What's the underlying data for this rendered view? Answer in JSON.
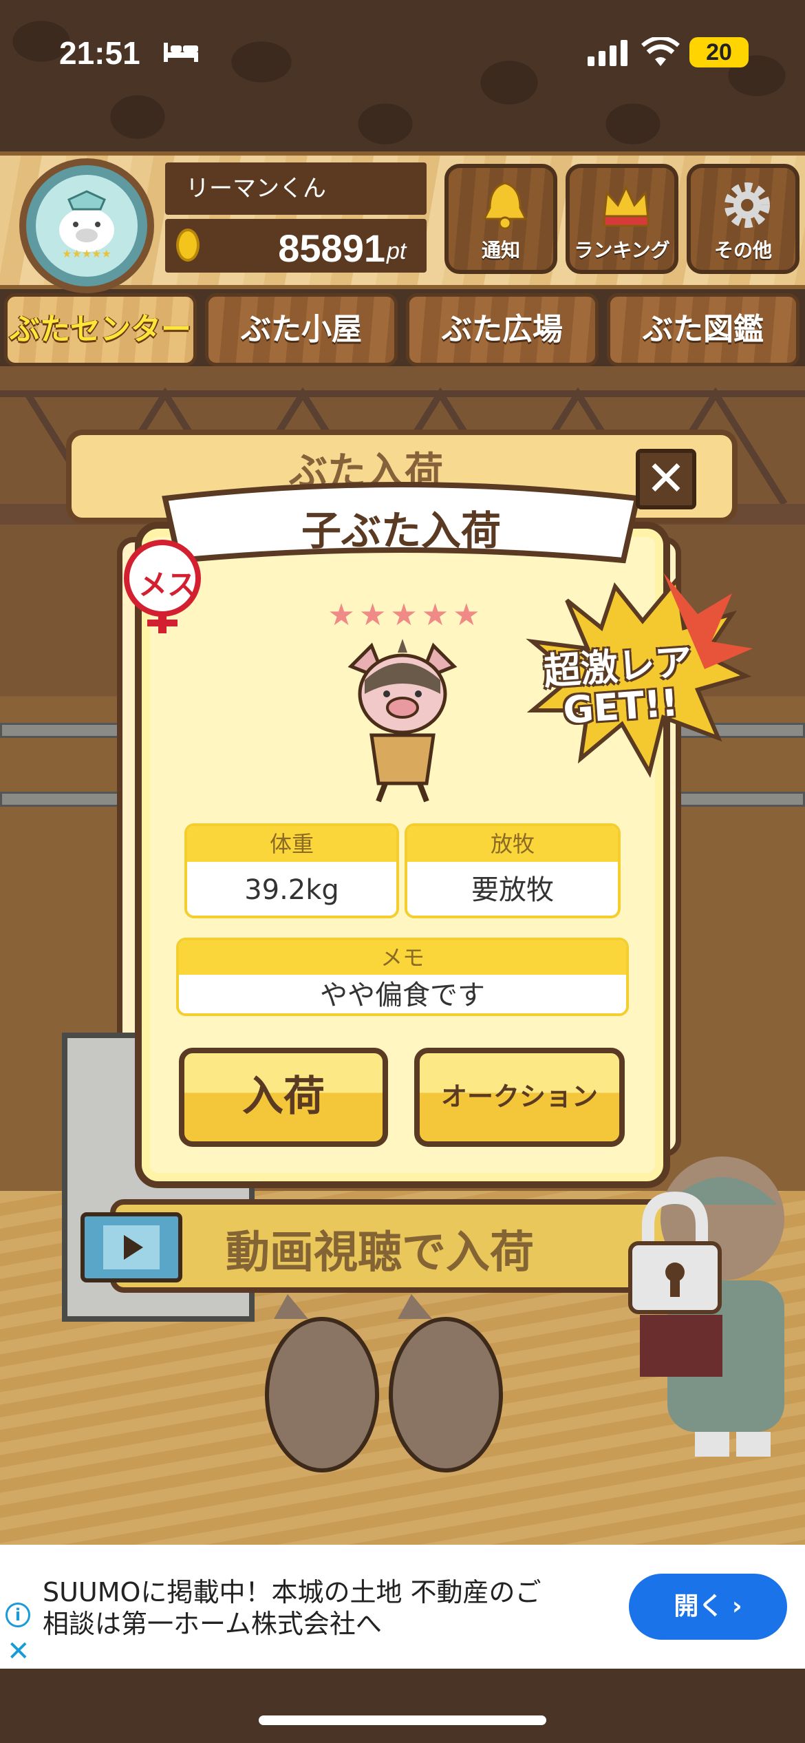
{
  "status_bar": {
    "time": "21:51",
    "battery": "20"
  },
  "header": {
    "user_name": "リーマンくん",
    "points": "85891",
    "points_unit": "pt",
    "buttons": [
      {
        "label": "通知",
        "icon": "bell-icon"
      },
      {
        "label": "ランキング",
        "icon": "crown-icon"
      },
      {
        "label": "その他",
        "icon": "gear-icon"
      }
    ]
  },
  "tabs": [
    {
      "label": "ぶたセンター",
      "active": true
    },
    {
      "label": "ぶた小屋",
      "active": false
    },
    {
      "label": "ぶた広場",
      "active": false
    },
    {
      "label": "ぶた図鑑",
      "active": false
    }
  ],
  "background": {
    "panel_title": "ぶた入荷",
    "video_button": "動画視聴で入荷"
  },
  "modal": {
    "title": "子ぶた入荷",
    "gender": "メス",
    "stars": "★★★★★",
    "rare_badge": "超激レア\nGET!!",
    "weight_label": "体重",
    "weight_value": "39.2kg",
    "grazing_label": "放牧",
    "grazing_value": "要放牧",
    "memo_label": "メモ",
    "memo_value": "やや偏食です",
    "arrive_button": "入荷",
    "auction_button": "オークション",
    "close": "✕"
  },
  "ad": {
    "text": "SUUMOに掲載中！本城の土地 不動産のご相談は第一ホーム株式会社へ",
    "button": "開く ›"
  }
}
